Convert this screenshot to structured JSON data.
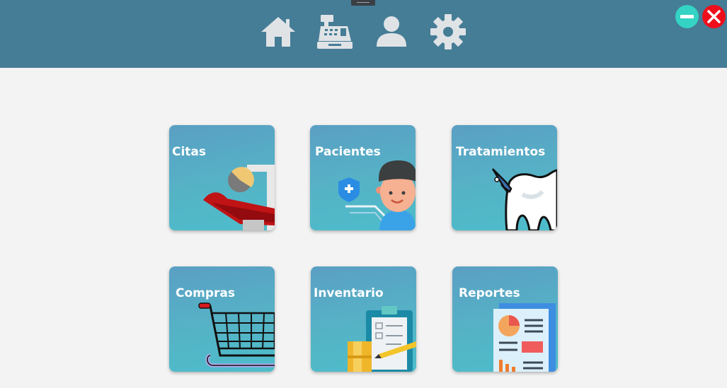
{
  "header": {
    "nav": [
      {
        "icon": "home-icon"
      },
      {
        "icon": "cash-register-icon"
      },
      {
        "icon": "user-icon"
      },
      {
        "icon": "gear-icon"
      }
    ],
    "window_controls": [
      {
        "icon": "minimize-icon",
        "color": "#34d3c3"
      },
      {
        "icon": "close-icon",
        "color": "#ee0e1b"
      }
    ]
  },
  "menu": {
    "tiles": [
      {
        "label": "Citas",
        "icon": "dental-chair-icon"
      },
      {
        "label": "Pacientes",
        "icon": "patient-icon"
      },
      {
        "label": "Tratamientos",
        "icon": "tooth-icon"
      },
      {
        "label": "Compras",
        "icon": "shopping-cart-icon"
      },
      {
        "label": "Inventario",
        "icon": "clipboard-inventory-icon"
      },
      {
        "label": "Reportes",
        "icon": "report-icon"
      }
    ]
  },
  "colors": {
    "header_bg": "#457c96",
    "page_bg": "#f3f3f3",
    "tile_gradient_top": "#5a9fc4",
    "tile_gradient_bottom": "#4dbdcb",
    "nav_icon": "#dfe3e6"
  }
}
